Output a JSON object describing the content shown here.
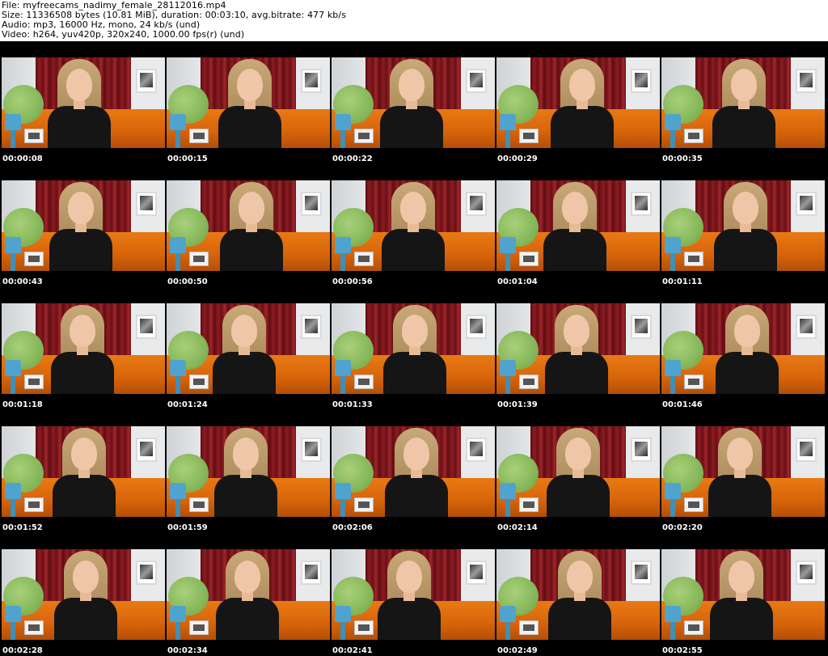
{
  "header": {
    "lines": [
      "File: myfreecams_nadimy_female_28112016.mp4",
      "Size: 11336508 bytes (10.81 MiB), duration: 00:03:10, avg.bitrate: 477 kb/s",
      "Audio: mp3, 16000 Hz, mono, 24 kb/s (und)",
      "Video: h264, yuv420p, 320x240, 1000.00 fps(r) (und)"
    ]
  },
  "thumbnails": [
    {
      "timestamp": "00:00:08"
    },
    {
      "timestamp": "00:00:15"
    },
    {
      "timestamp": "00:00:22"
    },
    {
      "timestamp": "00:00:29"
    },
    {
      "timestamp": "00:00:35"
    },
    {
      "timestamp": "00:00:43"
    },
    {
      "timestamp": "00:00:50"
    },
    {
      "timestamp": "00:00:56"
    },
    {
      "timestamp": "00:01:04"
    },
    {
      "timestamp": "00:01:11"
    },
    {
      "timestamp": "00:01:18"
    },
    {
      "timestamp": "00:01:24"
    },
    {
      "timestamp": "00:01:33"
    },
    {
      "timestamp": "00:01:39"
    },
    {
      "timestamp": "00:01:46"
    },
    {
      "timestamp": "00:01:52"
    },
    {
      "timestamp": "00:01:59"
    },
    {
      "timestamp": "00:02:06"
    },
    {
      "timestamp": "00:02:14"
    },
    {
      "timestamp": "00:02:20"
    },
    {
      "timestamp": "00:02:28"
    },
    {
      "timestamp": "00:02:34"
    },
    {
      "timestamp": "00:02:41"
    },
    {
      "timestamp": "00:02:49"
    },
    {
      "timestamp": "00:02:55"
    }
  ]
}
